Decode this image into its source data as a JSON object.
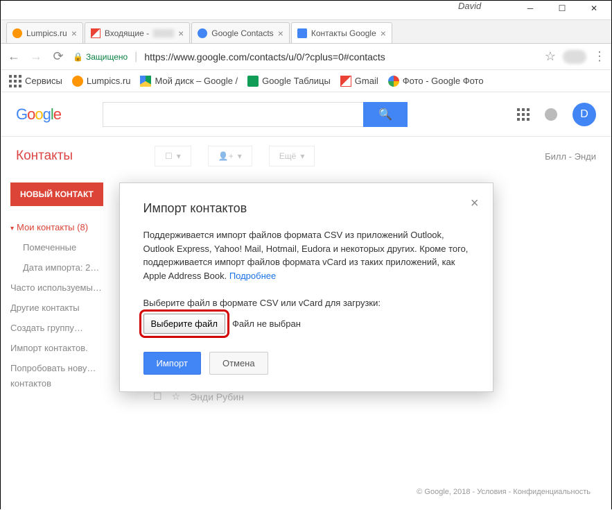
{
  "window": {
    "user": "David"
  },
  "tabs": [
    {
      "label": "Lumpics.ru",
      "icon": "orange"
    },
    {
      "label": "Входящие -",
      "icon": "gmail",
      "blurred": true
    },
    {
      "label": "Google Contacts",
      "icon": "gblue"
    },
    {
      "label": "Контакты Google",
      "icon": "gdoc",
      "active": true
    }
  ],
  "address": {
    "secure_label": "Защищено",
    "url": "https://www.google.com/contacts/u/0/?cplus=0#contacts"
  },
  "bookmarks": {
    "apps": "Сервисы",
    "items": [
      "Lumpics.ru",
      "Мой диск – Google /",
      "Google Таблицы",
      "Gmail",
      "Фото - Google Фото"
    ]
  },
  "header": {
    "avatar_letter": "D"
  },
  "sub": {
    "title": "Контакты",
    "more": "Ещё",
    "range": "Билл - Энди"
  },
  "sidebar": {
    "new_contact": "НОВЫЙ КОНТАКТ",
    "my_contacts": "Мои контакты (8)",
    "starred": "Помеченные",
    "import_date": "Дата импорта: 2…",
    "frequent": "Часто используемы…",
    "other": "Другие контакты",
    "create_group": "Создать группу…",
    "import": "Импорт контактов.",
    "try_new": "Попробовать нову…",
    "try_new2": "контактов"
  },
  "dialog": {
    "title": "Импорт контактов",
    "body": "Поддерживается импорт файлов формата CSV из приложений Outlook, Outlook Express, Yahoo! Mail, Hotmail, Eudora и некоторых других. Кроме того, поддерживается импорт файлов формата vCard из таких приложений, как Apple Address Book.  ",
    "more": "Подробнее",
    "select_label": "Выберите файл в формате CSV или vCard для загрузки:",
    "choose_file": "Выберите файл",
    "no_file": "Файл не выбран",
    "import_btn": "Импорт",
    "cancel_btn": "Отмена"
  },
  "contact_row": "Энди Рубин",
  "footer": {
    "copyright": "© Google, 2018 -",
    "terms": "Условия",
    "privacy": "Конфиденциальность"
  }
}
